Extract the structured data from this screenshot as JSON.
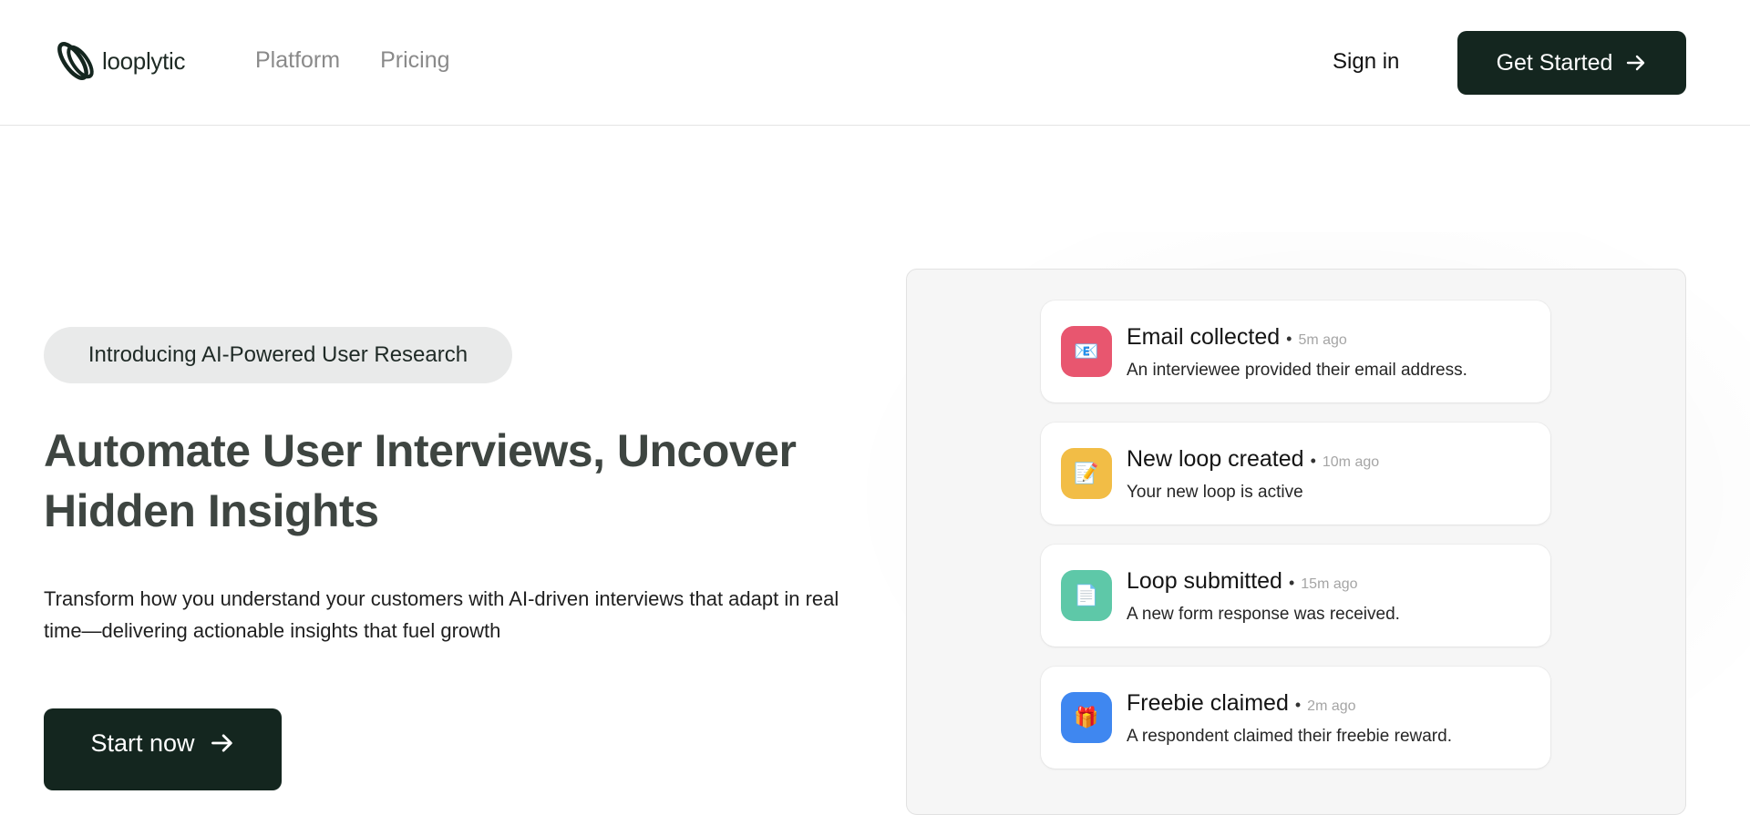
{
  "brand": {
    "name": "looplytic"
  },
  "nav": {
    "items": [
      {
        "label": "Platform"
      },
      {
        "label": "Pricing"
      }
    ]
  },
  "header": {
    "signin_label": "Sign in",
    "cta_label": "Get Started"
  },
  "hero": {
    "badge": "Introducing AI-Powered User Research",
    "headline": "Automate User Interviews, Uncover Hidden Insights",
    "subtext": "Transform how you understand your customers with AI-driven interviews that adapt in real time—delivering actionable insights that fuel growth",
    "cta_label": "Start now"
  },
  "feed": {
    "items": [
      {
        "icon": "email-card-icon",
        "emoji": "📧",
        "color": "#e8566f",
        "title": "Email collected",
        "time": "5m ago",
        "description": "An interviewee provided their email address."
      },
      {
        "icon": "memo-icon",
        "emoji": "📝",
        "color": "#f2bd46",
        "title": "New loop created",
        "time": "10m ago",
        "description": "Your new loop is active"
      },
      {
        "icon": "document-icon",
        "emoji": "📄",
        "color": "#5ec8a8",
        "title": "Loop submitted",
        "time": "15m ago",
        "description": "A new form response was received."
      },
      {
        "icon": "gift-icon",
        "emoji": "🎁",
        "color": "#3f87f0",
        "title": "Freebie claimed",
        "time": "2m ago",
        "description": "A respondent claimed their freebie reward."
      }
    ]
  },
  "colors": {
    "primary": "#14261f",
    "muted_nav": "#8a8a8a",
    "headline": "#3e4541"
  }
}
